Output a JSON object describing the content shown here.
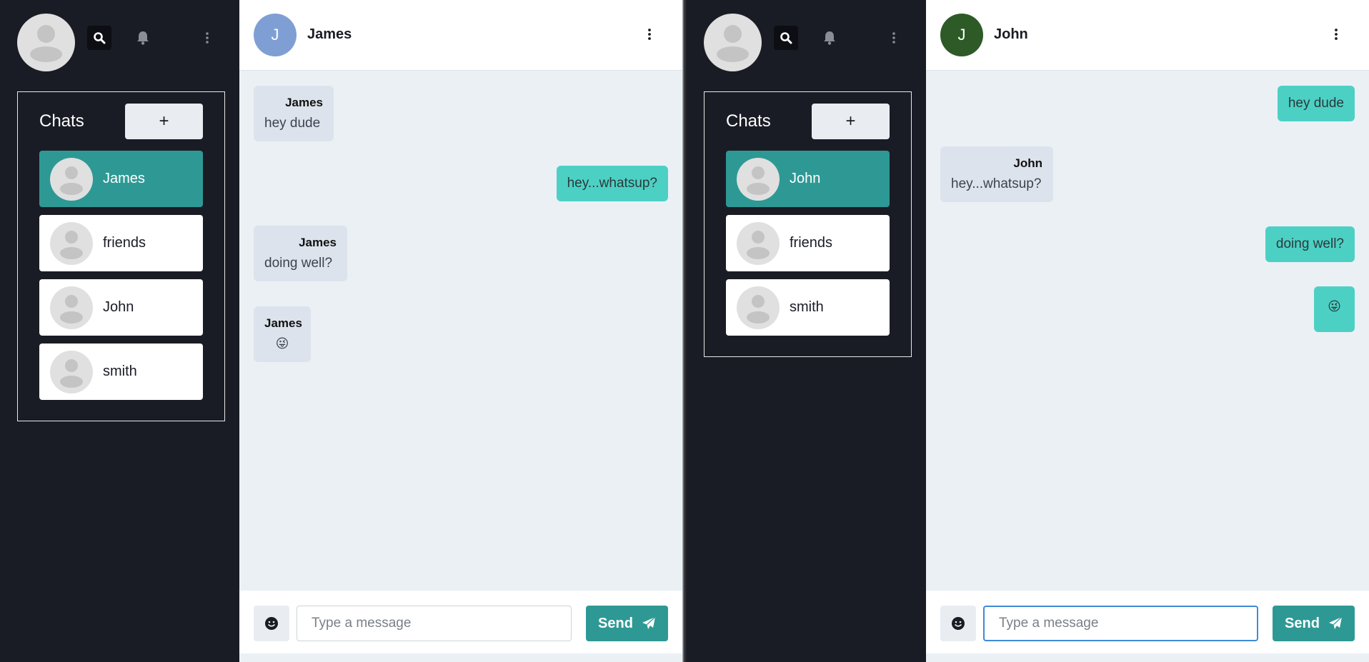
{
  "colors": {
    "sidebar_bg": "#1a1c25",
    "accent": "#2e9994",
    "outgoing_bubble": "#4dd0c4",
    "incoming_bubble": "#dde3ec",
    "chat_bg": "#ebf0f5"
  },
  "left": {
    "sidebar": {
      "chats_title": "Chats",
      "add_label": "+",
      "items": [
        {
          "label": "James",
          "active": true
        },
        {
          "label": "friends",
          "active": false
        },
        {
          "label": "John",
          "active": false
        },
        {
          "label": "smith",
          "active": false
        }
      ]
    },
    "header": {
      "initial": "J",
      "name": "James",
      "avatar_color": "#7f9fd4"
    },
    "messages": [
      {
        "direction": "in",
        "sender": "James",
        "text": "hey dude"
      },
      {
        "direction": "out",
        "text": "hey...whatsup?"
      },
      {
        "direction": "in",
        "sender": "James",
        "text": "doing well?"
      },
      {
        "direction": "in",
        "sender": "James",
        "text": "😜"
      }
    ],
    "composer": {
      "placeholder": "Type a message",
      "send_label": "Send"
    }
  },
  "right": {
    "sidebar": {
      "chats_title": "Chats",
      "add_label": "+",
      "items": [
        {
          "label": "John",
          "active": true
        },
        {
          "label": "friends",
          "active": false
        },
        {
          "label": "smith",
          "active": false
        }
      ]
    },
    "header": {
      "initial": "J",
      "name": "John",
      "avatar_color": "#2d5a27"
    },
    "messages": [
      {
        "direction": "out",
        "text": "hey dude"
      },
      {
        "direction": "in",
        "sender": "John",
        "text": "hey...whatsup?"
      },
      {
        "direction": "out",
        "text": "doing well?"
      },
      {
        "direction": "out",
        "text": "😜"
      }
    ],
    "composer": {
      "placeholder": "Type a message",
      "send_label": "Send"
    }
  },
  "icons": {
    "search": "search-icon",
    "notifications": "bell-icon",
    "menu": "more-vertical-icon",
    "emoji": "smiley-icon",
    "send": "paper-plane-icon"
  }
}
